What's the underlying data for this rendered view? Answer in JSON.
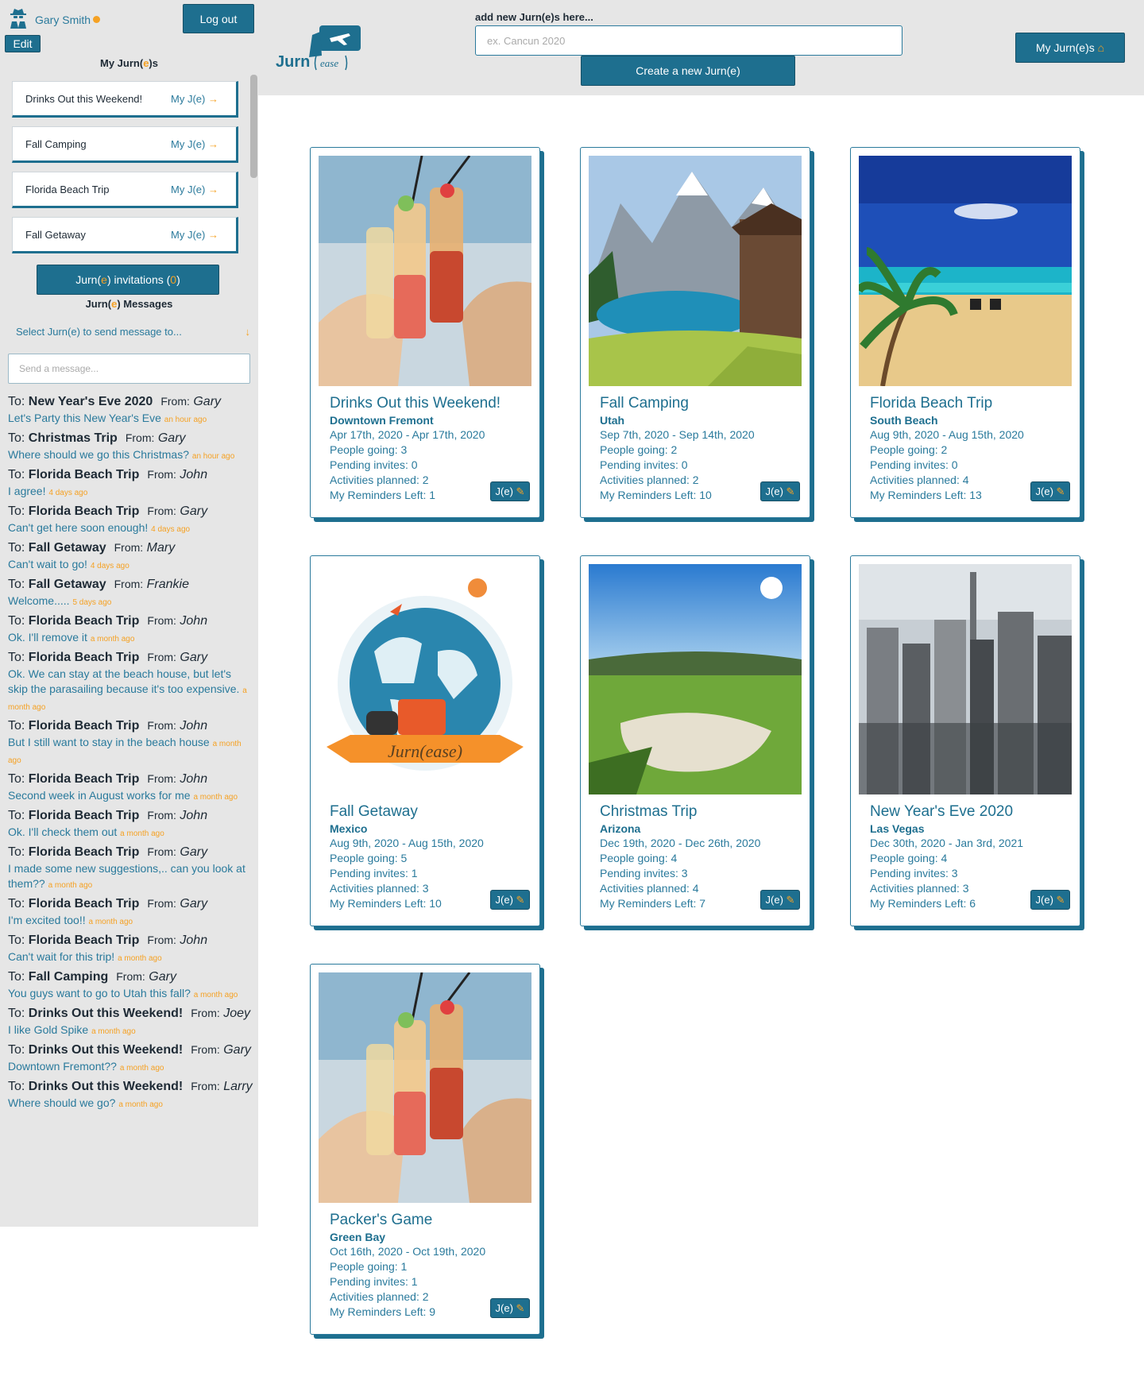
{
  "user": {
    "name": "Gary Smith",
    "status_color": "#f5a123"
  },
  "sidebar": {
    "logout_label": "Log out",
    "edit_label": "Edit",
    "heading": {
      "pre": "My Jurn(",
      "mid": "e",
      "post": ")s"
    },
    "jurnes": [
      {
        "name": "Drinks Out this Weekend!",
        "link": "My J(e)"
      },
      {
        "name": "Fall Camping",
        "link": "My J(e)"
      },
      {
        "name": "Florida Beach Trip",
        "link": "My J(e)"
      },
      {
        "name": "Fall Getaway",
        "link": "My J(e)"
      }
    ],
    "invitations": {
      "pre": "Jurn(",
      "mid": "e",
      "post": ") invitations (",
      "count": "0",
      "close": ")"
    },
    "messages_heading": {
      "pre": "Jurn(",
      "mid": "e",
      "post": ") Messages"
    },
    "select_label": "Select Jurn(e) to send message to...",
    "message_placeholder": "Send a message..."
  },
  "messages": [
    {
      "trip": "New Year's Eve 2020",
      "from": "Gary",
      "text": "Let's Party this New Year's Eve",
      "time": "an hour ago"
    },
    {
      "trip": "Christmas Trip",
      "from": "Gary",
      "text": "Where should we go this Christmas?",
      "time": "an hour ago"
    },
    {
      "trip": "Florida Beach Trip",
      "from": "John",
      "text": "I agree!",
      "time": "4 days ago"
    },
    {
      "trip": "Florida Beach Trip",
      "from": "Gary",
      "text": "Can't get here soon enough!",
      "time": "4 days ago"
    },
    {
      "trip": "Fall Getaway",
      "from": "Mary",
      "text": "Can't wait to go!",
      "time": "4 days ago"
    },
    {
      "trip": "Fall Getaway",
      "from": "Frankie",
      "text": "Welcome.....",
      "time": "5 days ago"
    },
    {
      "trip": "Florida Beach Trip",
      "from": "John",
      "text": "Ok. I'll remove it",
      "time": "a month ago"
    },
    {
      "trip": "Florida Beach Trip",
      "from": "Gary",
      "text": "Ok. We can stay at the beach house, but let's skip the parasailing because it's too expensive.",
      "time": "a month ago"
    },
    {
      "trip": "Florida Beach Trip",
      "from": "John",
      "text": "But I still want to stay in the beach house",
      "time": "a month ago"
    },
    {
      "trip": "Florida Beach Trip",
      "from": "John",
      "text": "Second week in August works for me",
      "time": "a month ago"
    },
    {
      "trip": "Florida Beach Trip",
      "from": "John",
      "text": "Ok. I'll check them out",
      "time": "a month ago"
    },
    {
      "trip": "Florida Beach Trip",
      "from": "Gary",
      "text": "I made some new suggestions,.. can you look at them??",
      "time": "a month ago"
    },
    {
      "trip": "Florida Beach Trip",
      "from": "Gary",
      "text": "I'm excited too!!",
      "time": "a month ago"
    },
    {
      "trip": "Florida Beach Trip",
      "from": "John",
      "text": "Can't wait for this trip!",
      "time": "a month ago"
    },
    {
      "trip": "Fall Camping",
      "from": "Gary",
      "text": "You guys want to go to Utah this fall?",
      "time": "a month ago"
    },
    {
      "trip": "Drinks Out this Weekend!",
      "from": "Joey",
      "text": "I like Gold Spike",
      "time": "a month ago"
    },
    {
      "trip": "Drinks Out this Weekend!",
      "from": "Gary",
      "text": "Downtown Fremont??",
      "time": "a month ago"
    },
    {
      "trip": "Drinks Out this Weekend!",
      "from": "Larry",
      "text": "Where should we go?",
      "time": "a month ago"
    }
  ],
  "labels": {
    "to": "To:",
    "from": "From:"
  },
  "header": {
    "add_label": "add new Jurn(e)s here...",
    "input_placeholder": "ex. Cancun 2020",
    "create_label": "Create a new Jurn(e)",
    "my_jurnes_label": "My Jurn(e)s",
    "logo_text": "Jurn",
    "logo_sub": "ease"
  },
  "card_labels": {
    "people": "People going:",
    "pending": "Pending invites:",
    "activities": "Activities planned:",
    "reminders": "My Reminders Left:",
    "edit_button": "J(e)"
  },
  "cards": [
    {
      "title": "Drinks Out this Weekend!",
      "location": "Downtown Fremont",
      "dates": "Apr 17th, 2020 - Apr 17th, 2020",
      "people": 3,
      "pending": 0,
      "activities": 2,
      "reminders": 1,
      "image": "drinks-photo"
    },
    {
      "title": "Fall Camping",
      "location": "Utah",
      "dates": "Sep 7th, 2020 - Sep 14th, 2020",
      "people": 2,
      "pending": 0,
      "activities": 2,
      "reminders": 10,
      "image": "mountain-lake-photo"
    },
    {
      "title": "Florida Beach Trip",
      "location": "South Beach",
      "dates": "Aug 9th, 2020 - Aug 15th, 2020",
      "people": 2,
      "pending": 0,
      "activities": 4,
      "reminders": 13,
      "image": "beach-photo"
    },
    {
      "title": "Fall Getaway",
      "location": "Mexico",
      "dates": "Aug 9th, 2020 - Aug 15th, 2020",
      "people": 5,
      "pending": 1,
      "activities": 3,
      "reminders": 10,
      "image": "jurnease-globe-illustration",
      "image_text": "Jurn(ease)"
    },
    {
      "title": "Christmas Trip",
      "location": "Arizona",
      "dates": "Dec 19th, 2020 - Dec 26th, 2020",
      "people": 4,
      "pending": 3,
      "activities": 4,
      "reminders": 7,
      "image": "golf-course-photo"
    },
    {
      "title": "New Year's Eve 2020",
      "location": "Las Vegas",
      "dates": "Dec 30th, 2020 - Jan 3rd, 2021",
      "people": 4,
      "pending": 3,
      "activities": 3,
      "reminders": 6,
      "image": "city-skyline-photo"
    },
    {
      "title": "Packer's Game",
      "location": "Green Bay",
      "dates": "Oct 16th, 2020 - Oct 19th, 2020",
      "people": 1,
      "pending": 1,
      "activities": 2,
      "reminders": 9,
      "image": "drinks-photo"
    }
  ],
  "colors": {
    "brand": "#1e6f8f",
    "accent": "#f5a123",
    "panel": "#e6e6e6"
  }
}
